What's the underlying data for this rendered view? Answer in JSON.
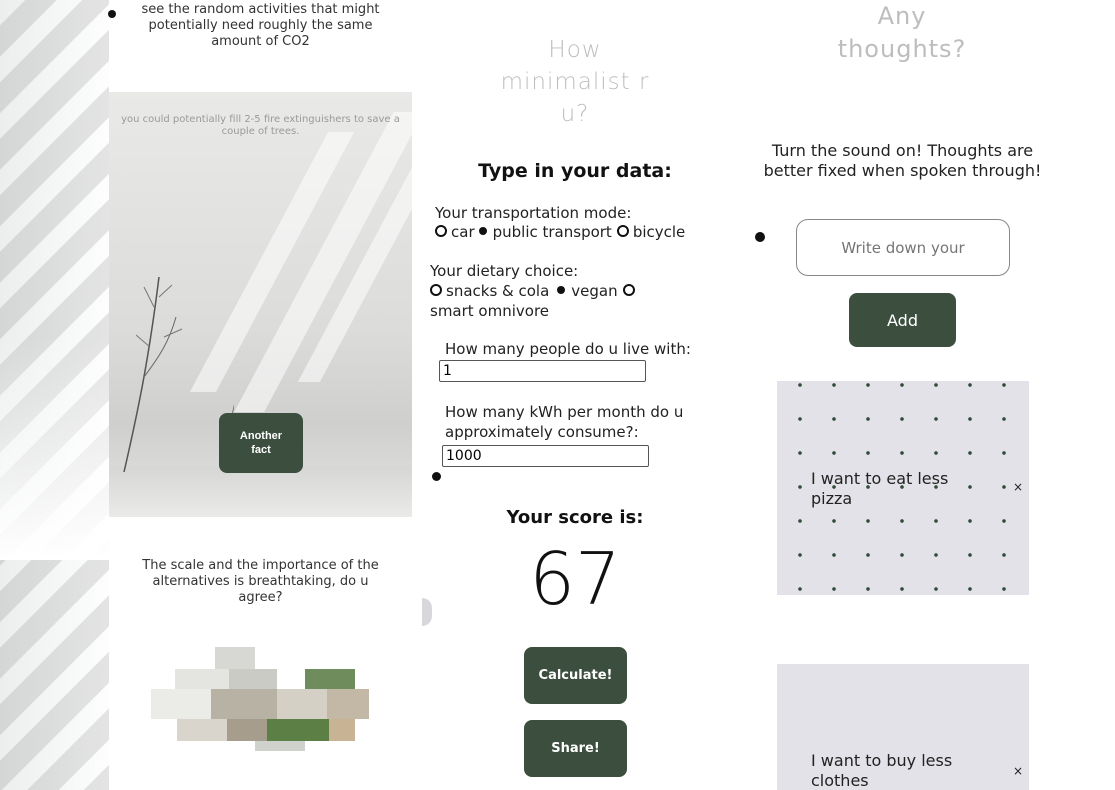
{
  "left": {
    "top_text": "see the random activities that might potentially need roughly the same amount of CO2",
    "photo_caption": "you could potentially fill 2-5 fire extinguishers to save a couple of trees.",
    "fact_button": "Another fact",
    "question": "The scale and the importance of the alternatives is breathtaking, do u agree?"
  },
  "calculator": {
    "title": "How minimalist r u?",
    "heading": "Type in your data:",
    "transport": {
      "label": "Your transportation mode:",
      "options": [
        "car",
        "public transport",
        "bicycle"
      ],
      "selected": "public transport"
    },
    "diet": {
      "label": "Your dietary choice:",
      "options": [
        "snacks & cola",
        "vegan",
        "smart omnivore"
      ],
      "selected": "vegan"
    },
    "people": {
      "label": "How many people do u live with:",
      "value": "1"
    },
    "kwh": {
      "label": "How many kWh per month do u approximately consume?:",
      "value": "1000"
    },
    "score_heading": "Your score is:",
    "score": "67",
    "calculate_button": "Calculate!",
    "share_button": "Share!"
  },
  "thoughts": {
    "title": "Any thoughts?",
    "description": "Turn the sound on! Thoughts are better fixed when spoken through!",
    "input_placeholder": "Write down your",
    "add_button": "Add",
    "notes": [
      {
        "text": "I want to eat less pizza",
        "close": "×"
      },
      {
        "text": "I want to buy less clothes",
        "close": "×"
      }
    ]
  },
  "colors": {
    "accent_green": "#3c4f3f",
    "note_bg": "#e2e2e8",
    "title_grey": "#bdbdbd"
  }
}
